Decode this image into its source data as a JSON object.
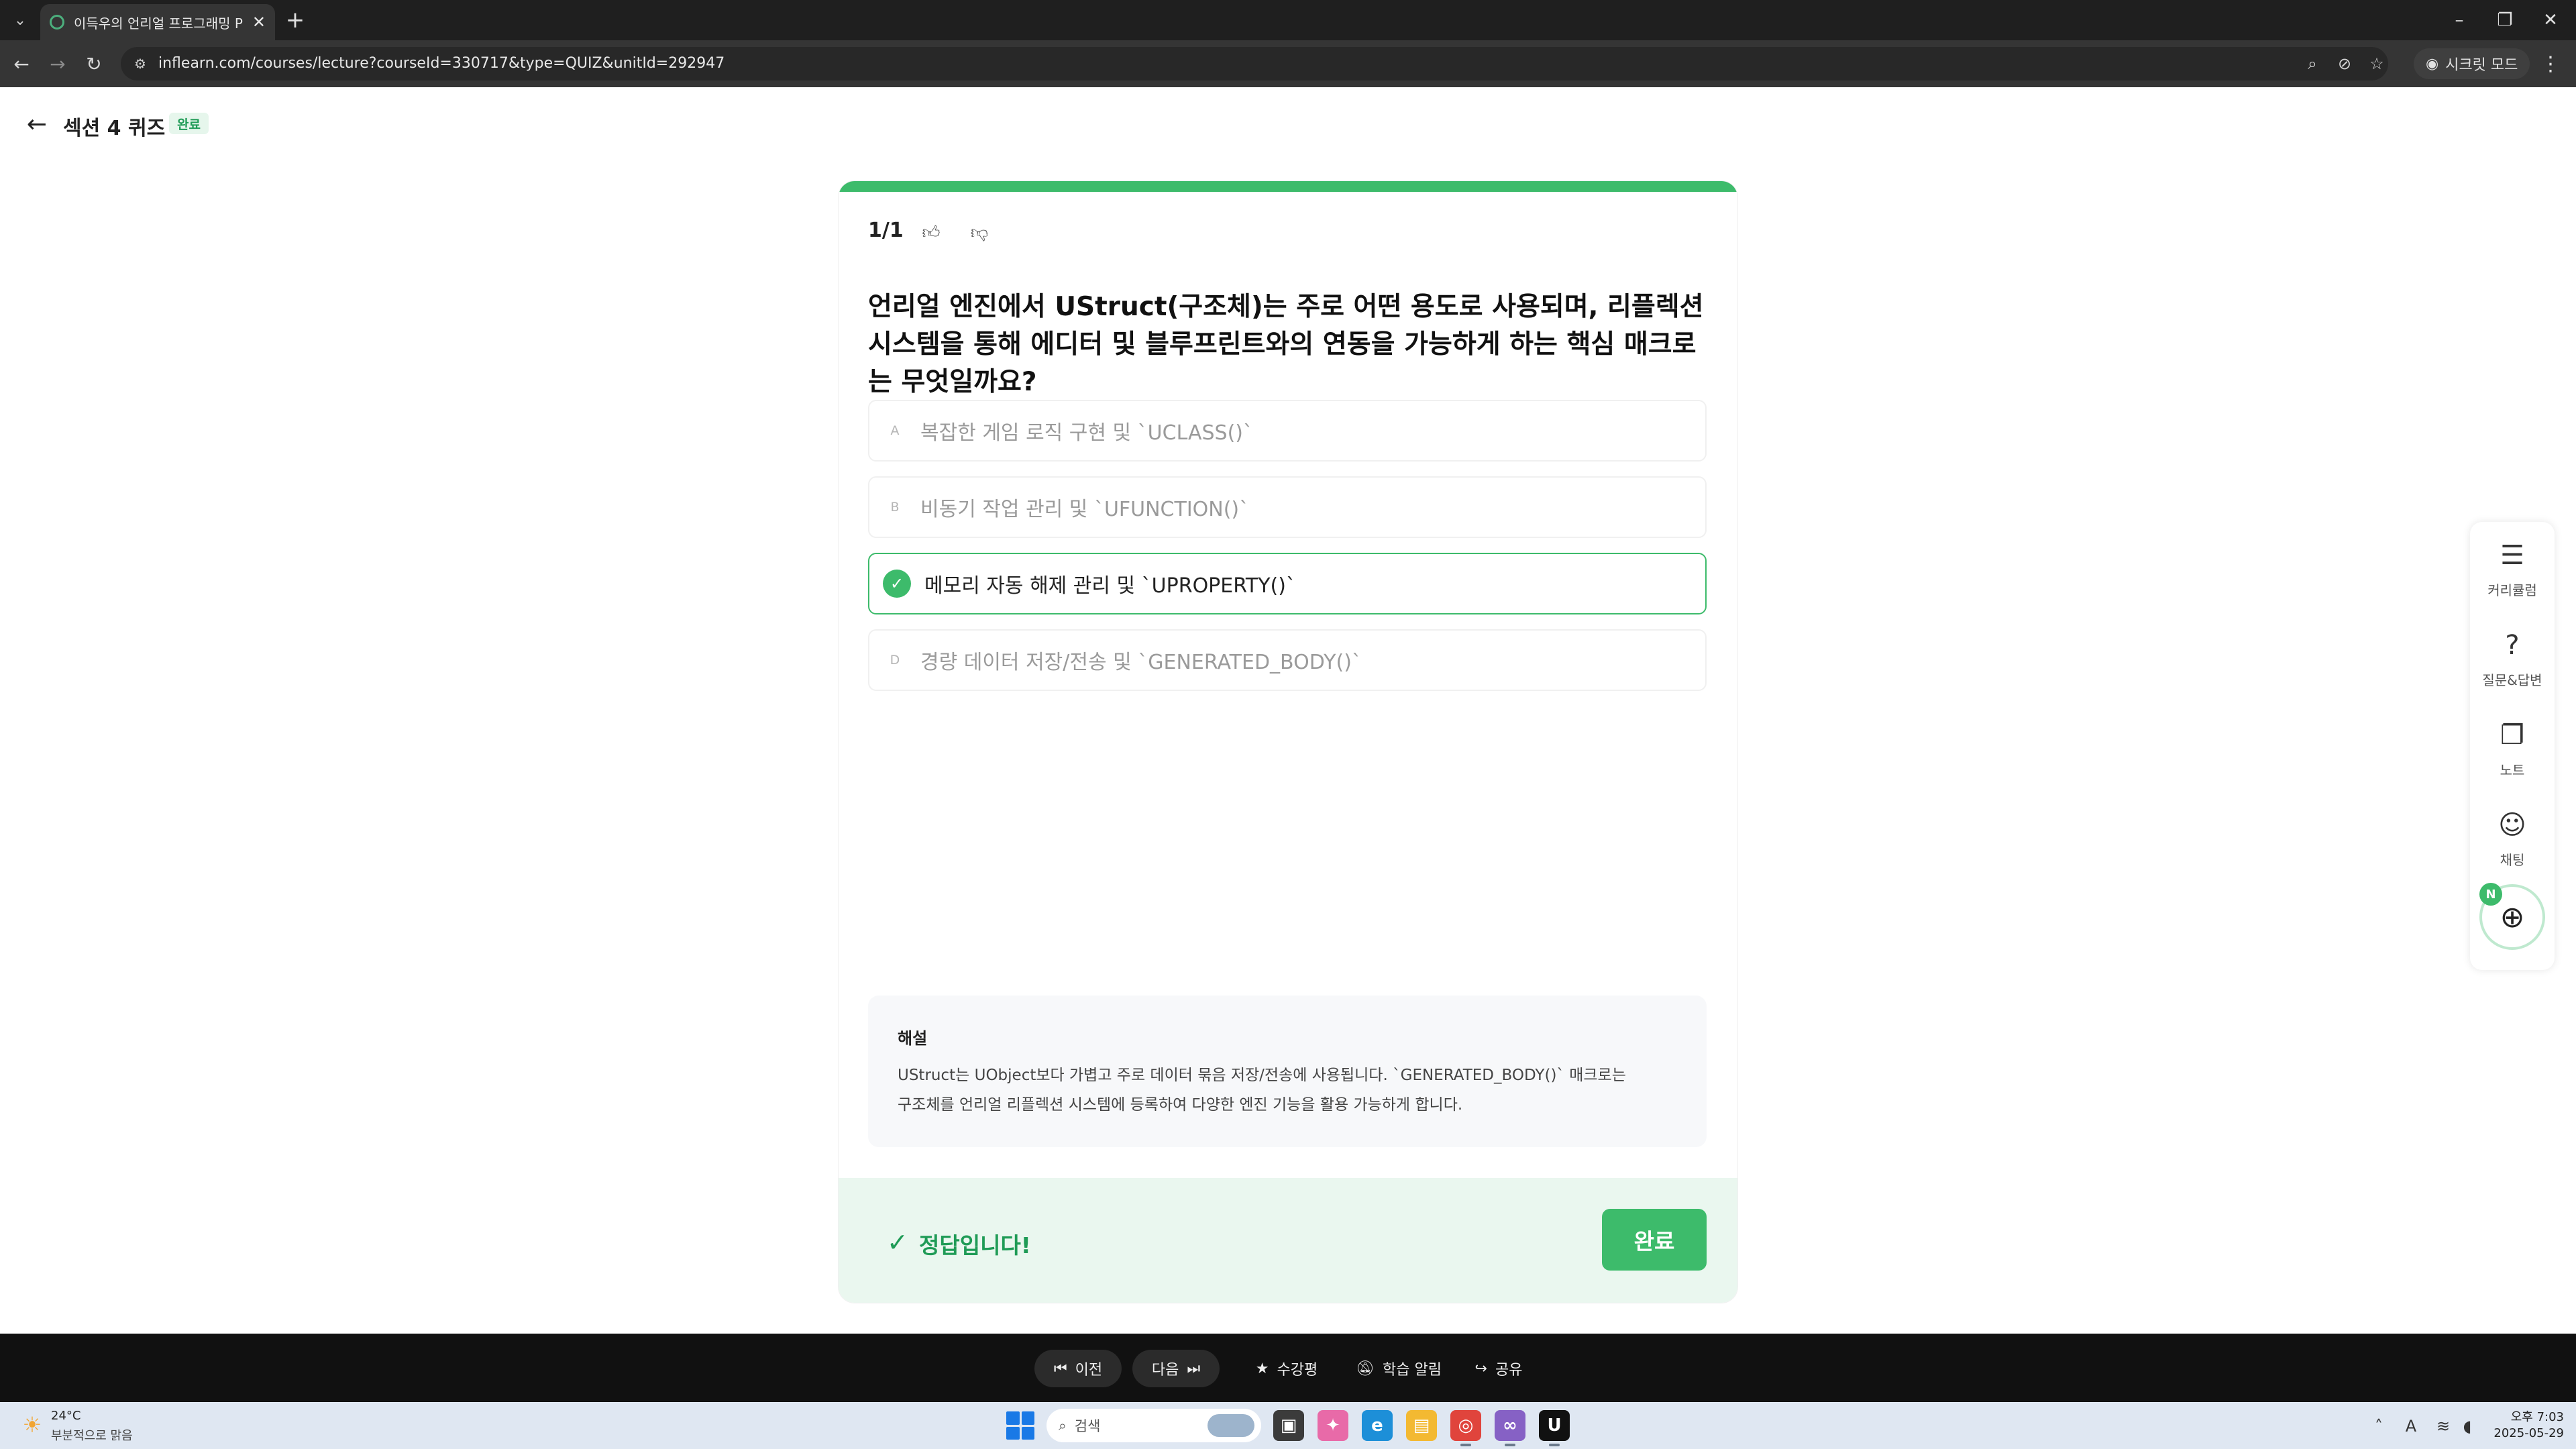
{
  "browser": {
    "tab_title": "이득우의 언리얼 프로그래밍 P",
    "url": "inflearn.com/courses/lecture?courseId=330717&type=QUIZ&unitId=292947",
    "incognito_label": "시크릿 모드"
  },
  "header": {
    "section_title": "섹션 4 퀴즈",
    "status": "완료"
  },
  "quiz": {
    "counter": "1/1",
    "progress": 1.0,
    "question": "언리얼 엔진에서 UStruct(구조체)는 주로 어떤 용도로 사용되며, 리플렉션 시스템을 통해 에디터 및 블루프린트와의 연동을 가능하게 하는 핵심 매크로는 무엇일까요?",
    "options": [
      {
        "letter": "A",
        "text": "복잡한 게임 로직 구현 및 `UCLASS()`",
        "selected": false
      },
      {
        "letter": "B",
        "text": "비동기 작업 관리 및 `UFUNCTION()`",
        "selected": false
      },
      {
        "letter": "C",
        "text": "메모리 자동 해제 관리 및 `UPROPERTY()`",
        "selected": true
      },
      {
        "letter": "D",
        "text": "경량 데이터 저장/전송 및 `GENERATED_BODY()`",
        "selected": false
      }
    ],
    "explanation_title": "해설",
    "explanation_line1": "UStruct는 UObject보다 가볍고 주로 데이터 묶음 저장/전송에 사용됩니다. `GENERATED_BODY()` 매크로는",
    "explanation_line2": "구조체를 언리얼 리플렉션 시스템에 등록하여 다양한 엔진 기능을 활용 가능하게 합니다.",
    "result_text": "정답입니다!",
    "done_label": "완료"
  },
  "side_panel": {
    "items": [
      {
        "label": "커리큘럼",
        "icon": "checklist-icon"
      },
      {
        "label": "질문&답변",
        "icon": "question-bubble-icon"
      },
      {
        "label": "노트",
        "icon": "note-icon"
      },
      {
        "label": "채팅",
        "icon": "smile-icon"
      }
    ],
    "globe_badge": "N"
  },
  "bottom_bar": {
    "prev_label": "이전",
    "next_label": "다음",
    "review_label": "수강평",
    "alarm_label": "학습 알림",
    "share_label": "공유"
  },
  "taskbar": {
    "weather_temp": "24°C",
    "weather_desc": "부분적으로 맑음",
    "search_placeholder": "검색",
    "clock_time": "오후 7:03",
    "clock_date": "2025-05-29",
    "ime_label": "A"
  },
  "colors": {
    "accent": "#3dbb6b",
    "accent_dark": "#1f9b56",
    "result_bg": "#eaf7ef"
  }
}
